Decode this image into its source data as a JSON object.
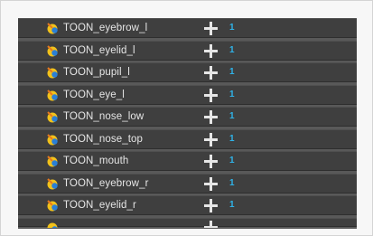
{
  "layers": [
    {
      "name": "TOON_eyebrow_l",
      "count": "1"
    },
    {
      "name": "TOON_eyelid_l",
      "count": "1"
    },
    {
      "name": "TOON_pupil_l",
      "count": "1"
    },
    {
      "name": "TOON_eye_l",
      "count": "1"
    },
    {
      "name": "TOON_nose_low",
      "count": "1"
    },
    {
      "name": "TOON_nose_top",
      "count": "1"
    },
    {
      "name": "TOON_mouth",
      "count": "1"
    },
    {
      "name": "TOON_eyebrow_r",
      "count": "1"
    },
    {
      "name": "TOON_eyelid_r",
      "count": "1"
    }
  ],
  "colors": {
    "panel_bg": "#595959",
    "row_bg": "#3f3f3f",
    "label": "#e6e6e6",
    "count": "#2fb3e8",
    "icon_yellow": "#f2c21a",
    "icon_blue": "#2a7fd6"
  },
  "icons": {
    "layer_icon": "toon-drawing-icon",
    "add_icon": "plus-icon"
  }
}
